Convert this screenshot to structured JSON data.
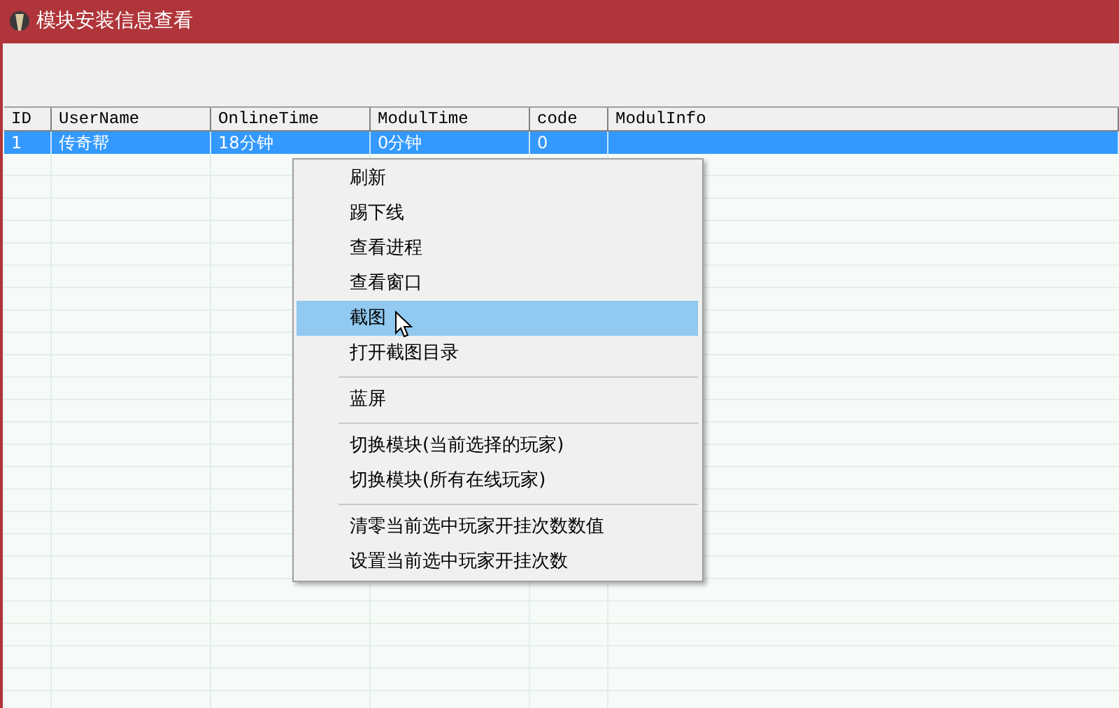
{
  "window": {
    "title": "模块安装信息查看"
  },
  "table": {
    "columns": [
      "ID",
      "UserName",
      "OnlineTime",
      "ModulTime",
      "code",
      "ModulInfo"
    ],
    "rows": [
      {
        "selected": true,
        "cells": [
          "1",
          "传奇帮",
          "18分钟",
          "0分钟",
          "0",
          ""
        ]
      }
    ]
  },
  "context_menu": {
    "items": [
      {
        "kind": "item",
        "label": "刷新",
        "selected": false
      },
      {
        "kind": "item",
        "label": "踢下线",
        "selected": false
      },
      {
        "kind": "item",
        "label": "查看进程",
        "selected": false
      },
      {
        "kind": "item",
        "label": "查看窗口",
        "selected": false
      },
      {
        "kind": "item",
        "label": "截图",
        "selected": true
      },
      {
        "kind": "item",
        "label": "打开截图目录",
        "selected": false
      },
      {
        "kind": "separator"
      },
      {
        "kind": "item",
        "label": "蓝屏",
        "selected": false
      },
      {
        "kind": "separator"
      },
      {
        "kind": "item",
        "label": "切换模块(当前选择的玩家)",
        "selected": false
      },
      {
        "kind": "item",
        "label": "切换模块(所有在线玩家)",
        "selected": false
      },
      {
        "kind": "separator"
      },
      {
        "kind": "item",
        "label": "清零当前选中玩家开挂次数数值",
        "selected": false
      },
      {
        "kind": "item",
        "label": "设置当前选中玩家开挂次数",
        "selected": false
      }
    ]
  }
}
